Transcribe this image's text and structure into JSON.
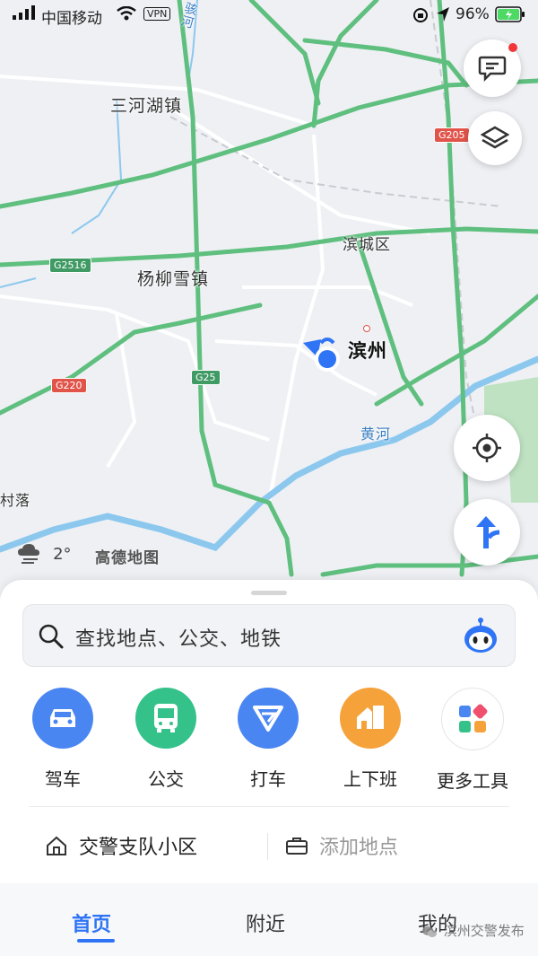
{
  "status_bar": {
    "carrier": "中国移动",
    "vpn": "VPN",
    "battery": "96%"
  },
  "map": {
    "place_labels": {
      "sanhe": "三河湖镇",
      "yangliu": "杨柳雪镇",
      "bincheng": "滨城区",
      "binzhou": "滨州",
      "huanghe": "黄河",
      "cunluo": "村落",
      "river_top": "骇河"
    },
    "road_shields": {
      "g205": "G205",
      "g2516": "G2516",
      "g220": "G220",
      "g25": "G25"
    },
    "weather": {
      "temperature": "2°",
      "icon": "cloud-rain-icon"
    },
    "logo": "高德地图",
    "colors": {
      "highway": "#5fbf7e",
      "river": "#8cc8ee",
      "location": "#2f74f5"
    }
  },
  "search": {
    "placeholder": "查找地点、公交、地铁"
  },
  "tools": [
    {
      "label": "驾车",
      "icon": "car-icon",
      "color": "#4a86f2"
    },
    {
      "label": "公交",
      "icon": "bus-icon",
      "color": "#35c18a"
    },
    {
      "label": "打车",
      "icon": "taxi-icon",
      "color": "#4a86f2"
    },
    {
      "label": "上下班",
      "icon": "commute-icon",
      "color": "#f6a23b"
    },
    {
      "label": "更多工具",
      "icon": "more-tools-icon",
      "color": "#ffffff"
    }
  ],
  "shortcuts": {
    "home_place": "交警支队小区",
    "add_place": "添加地点"
  },
  "tabs": {
    "home": "首页",
    "nearby": "附近",
    "mine": "我的"
  },
  "watermark": "滨州交警发布"
}
